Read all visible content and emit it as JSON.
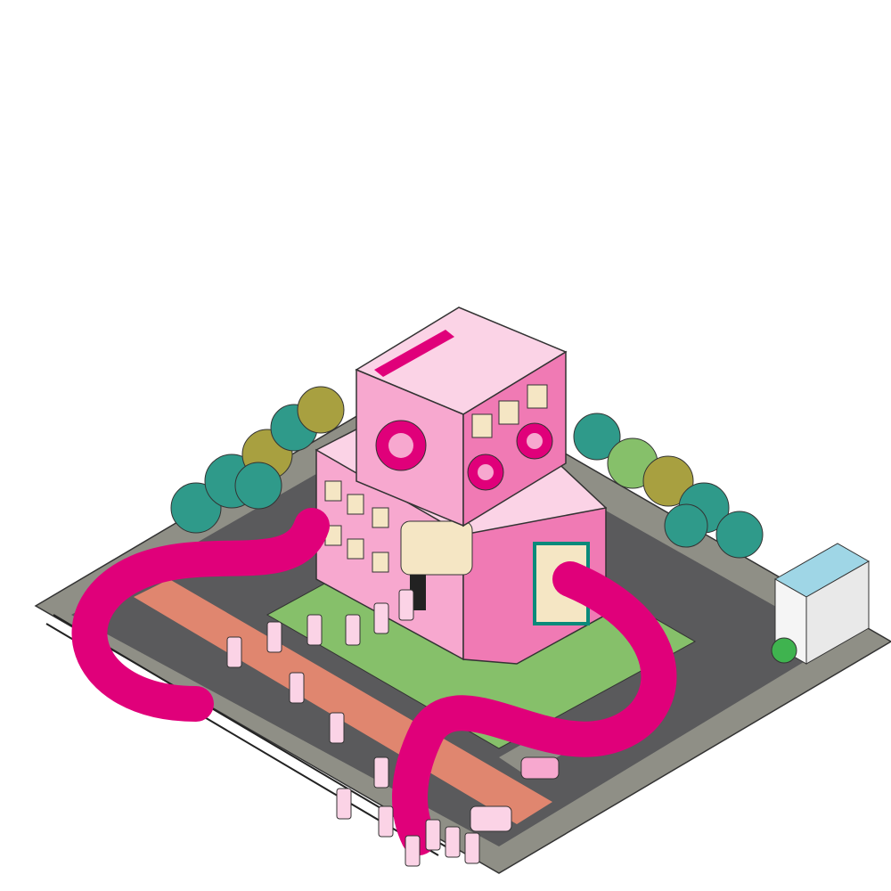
{
  "scene": {
    "description_tag": "isometric-city-block",
    "palette": {
      "magenta": "#e0007a",
      "pink_light": "#f7a8cf",
      "pink_mid": "#f07ab4",
      "pink_pale": "#fbd3e6",
      "road": "#5a5a5c",
      "sidewalk": "#8f8f86",
      "grass": "#86c06a",
      "salmon_strip": "#e0866f",
      "tree_teal": "#2f9a8a",
      "tree_olive": "#a8a040",
      "window_cream": "#f5e6c4",
      "shop_blue": "#9fd6e6"
    },
    "icons": [
      "speaker-icon",
      "tree-icon",
      "car-icon",
      "robot-figure-icon"
    ]
  }
}
